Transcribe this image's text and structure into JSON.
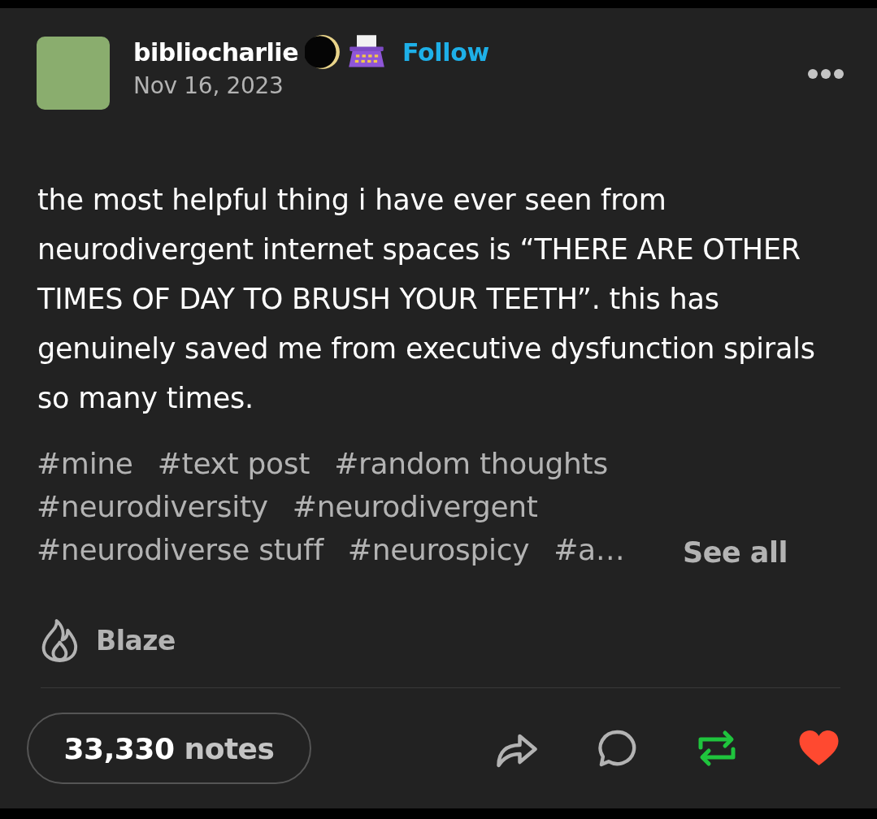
{
  "post": {
    "author": {
      "name": "bibliocharlie",
      "badges": [
        {
          "kind": "moon"
        },
        {
          "kind": "typewriter"
        }
      ],
      "follow": "Follow",
      "date": "Nov 16, 2023"
    },
    "body": "the most helpful thing i have ever seen from neurodivergent internet spaces is “THERE ARE OTHER TIMES OF DAY TO BRUSH YOUR TEETH”. this has genuinely saved me from executive dysfunction spirals so many times.",
    "tags": [
      "#mine",
      "#text post",
      "#random thoughts",
      "#neurodiversity",
      "#neurodivergent",
      "#neurodiverse stuff",
      "#neurospicy",
      "#a…"
    ],
    "see_all": "See all",
    "blaze": "Blaze",
    "notes": {
      "count": "33,330",
      "label": "notes"
    },
    "actions": [
      {
        "kind": "share",
        "active": false
      },
      {
        "kind": "reply",
        "active": false
      },
      {
        "kind": "reblog",
        "active": true
      },
      {
        "kind": "like",
        "active": true
      }
    ]
  }
}
